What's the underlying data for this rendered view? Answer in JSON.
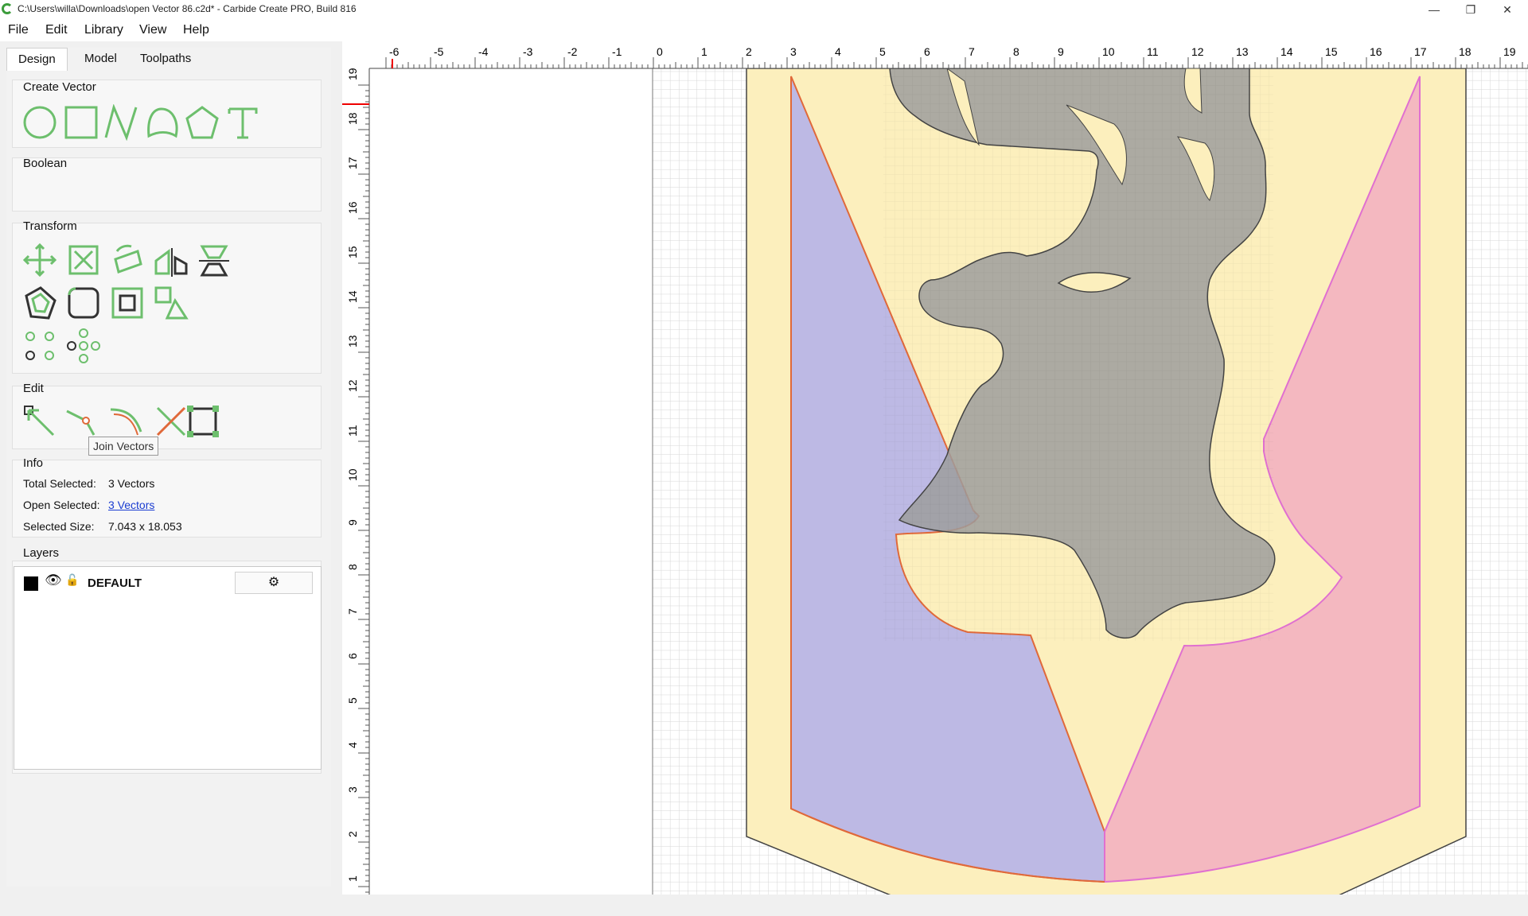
{
  "window": {
    "title": "C:\\Users\\willa\\Downloads\\open Vector 86.c2d* - Carbide Create PRO, Build 816",
    "minimize": "—",
    "maximize": "❐",
    "close": "✕"
  },
  "menu": [
    "File",
    "Edit",
    "Library",
    "View",
    "Help"
  ],
  "tabs": [
    "Design",
    "Model",
    "Toolpaths"
  ],
  "groups": {
    "create_vector": "Create Vector",
    "boolean": "Boolean",
    "transform": "Transform",
    "edit": "Edit",
    "info": "Info",
    "layers": "Layers"
  },
  "tooltip": "Join Vectors",
  "info": {
    "total_label": "Total Selected:",
    "total_value": "3 Vectors",
    "open_label": "Open Selected:",
    "open_value": "3 Vectors",
    "size_label": "Selected Size:",
    "size_value": "7.043 x 18.053"
  },
  "layers": [
    {
      "name": "DEFAULT",
      "color": "#000000"
    }
  ],
  "ruler": {
    "h_labels": [
      "-6",
      "-5",
      "-4",
      "-3",
      "-2",
      "-1",
      "0",
      "1",
      "2",
      "3",
      "4",
      "5",
      "6",
      "7",
      "8",
      "9",
      "10",
      "11",
      "12",
      "13",
      "14",
      "15",
      "16",
      "17",
      "18",
      "19"
    ],
    "v_labels": [
      "19",
      "18",
      "17",
      "16",
      "15",
      "14",
      "13",
      "12",
      "11",
      "10",
      "9",
      "8",
      "7",
      "6",
      "5",
      "4",
      "3",
      "2",
      "1"
    ]
  },
  "colors": {
    "accent_green": "#6dbf6d",
    "shield_fill": "#fcefbd",
    "purple_fill": "#bdb9e4",
    "pink_fill": "#f4b8c0",
    "deer_fill": "#9e9e9e",
    "orange_stroke": "#e0693a",
    "magenta_stroke": "#e070d0"
  }
}
